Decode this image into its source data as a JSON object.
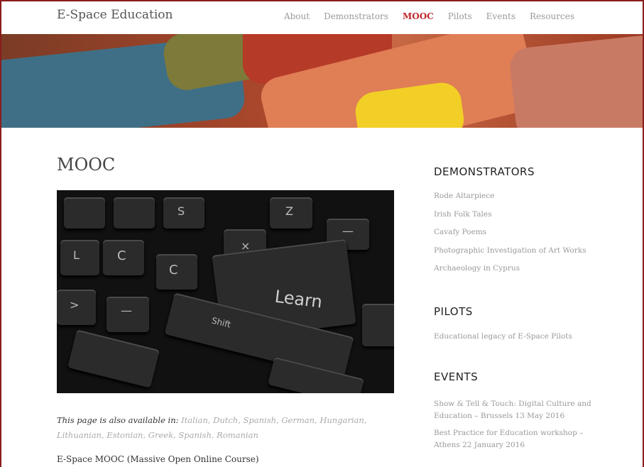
{
  "site": {
    "title": "E-Space Education"
  },
  "nav": {
    "items": [
      {
        "label": "About"
      },
      {
        "label": "Demonstrators"
      },
      {
        "label": "MOOC"
      },
      {
        "label": "Pilots"
      },
      {
        "label": "Events"
      },
      {
        "label": "Resources"
      }
    ],
    "active": "MOOC"
  },
  "page": {
    "title": "MOOC",
    "available_lead": "This page is also available in:",
    "languages": [
      "Italian",
      "Dutch",
      "Spanish",
      "German",
      "Hungarian",
      "Lithuanian",
      "Estonian",
      "Greek",
      "Spanish",
      "Romanian"
    ],
    "course_text": "E-Space MOOC (Massive Open Online Course)",
    "hero_keys": {
      "learn": "Learn",
      "shift": "Shift"
    }
  },
  "sidebar": {
    "demonstrators": {
      "title": "DEMONSTRATORS",
      "items": [
        "Rode Altarpiece",
        "Irish Folk Tales",
        "Cavafy Poems",
        "Photographic Investigation of Art Works",
        "Archaeology in Cyprus"
      ]
    },
    "pilots": {
      "title": "PILOTS",
      "items": [
        "Educational legacy of E-Space Pilots"
      ]
    },
    "events": {
      "title": "EVENTS",
      "items": [
        "Show & Tell & Touch: Digital Culture and Education – Brussels 13 May 2016",
        "Best Practice for Education workshop – Athens 22 January 2016"
      ]
    }
  },
  "colors": {
    "accent": "#c0262b",
    "frame": "#8a1c1c",
    "link_muted": "#999999"
  }
}
